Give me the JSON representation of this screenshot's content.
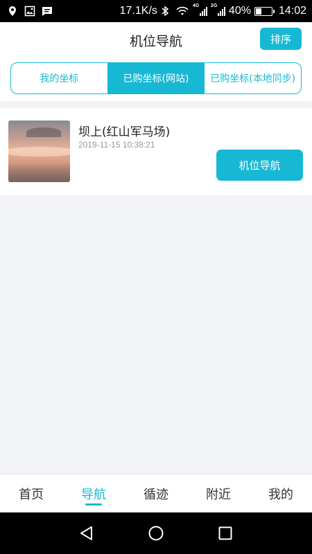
{
  "status_bar": {
    "speed": "17.1K/s",
    "network_1": "4G",
    "network_2": "2G",
    "battery_percent_text": "40%",
    "battery_level": 0.4,
    "time": "14:02"
  },
  "header": {
    "title": "机位导航",
    "sort_label": "排序"
  },
  "tabs": [
    {
      "label": "我的坐标",
      "active": false
    },
    {
      "label": "已购坐标(网站)",
      "active": true
    },
    {
      "label": "已购坐标(本地同步)",
      "active": false
    }
  ],
  "list": [
    {
      "title": "坝上(红山军马场)",
      "time": "2019-11-15 10:38:21",
      "button": "机位导航"
    }
  ],
  "bottom_nav": [
    {
      "label": "首页",
      "active": false
    },
    {
      "label": "导航",
      "active": true
    },
    {
      "label": "循迹",
      "active": false
    },
    {
      "label": "附近",
      "active": false
    },
    {
      "label": "我的",
      "active": false
    }
  ],
  "colors": {
    "accent": "#17b8d4",
    "background": "#f2f3f7"
  }
}
